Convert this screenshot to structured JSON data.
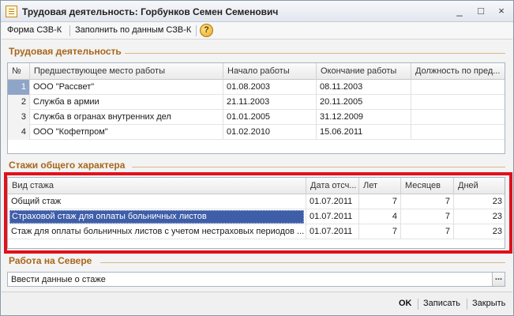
{
  "window": {
    "title": "Трудовая деятельность: Горбунков Семен Семенович",
    "minimize": "_",
    "maximize": "□",
    "close": "×"
  },
  "toolbar": {
    "form_button": "Форма СЗВ-К",
    "fill_button": "Заполнить по данным СЗВ-К",
    "help": "?"
  },
  "work_section": {
    "title": "Трудовая деятельность",
    "columns": [
      "№",
      "Предшествующее место работы",
      "Начало работы",
      "Окончание работы",
      "Должность по пред..."
    ],
    "rows": [
      {
        "num": "1",
        "place": "ООО \"Рассвет\"",
        "start": "01.08.2003",
        "end": "08.11.2003",
        "position": ""
      },
      {
        "num": "2",
        "place": "Служба в армии",
        "start": "21.11.2003",
        "end": "20.11.2005",
        "position": ""
      },
      {
        "num": "3",
        "place": "Служба в огранах внутренних дел",
        "start": "01.01.2005",
        "end": "31.12.2009",
        "position": ""
      },
      {
        "num": "4",
        "place": "ООО \"Кофетпром\"",
        "start": "01.02.2010",
        "end": "15.06.2011",
        "position": ""
      }
    ]
  },
  "experience_section": {
    "title": "Стажи общего характера",
    "columns": [
      "Вид стажа",
      "Дата отсч...",
      "Лет",
      "Месяцев",
      "Дней"
    ],
    "rows": [
      {
        "type": "Общий стаж",
        "date": "01.07.2011",
        "years": "7",
        "months": "7",
        "days": "23"
      },
      {
        "type": "Страховой стаж для оплаты больничных листов",
        "date": "01.07.2011",
        "years": "4",
        "months": "7",
        "days": "23"
      },
      {
        "type": "Стаж для оплаты больничных листов с учетом нестраховых периодов ...",
        "date": "01.07.2011",
        "years": "7",
        "months": "7",
        "days": "23"
      }
    ]
  },
  "north_section": {
    "title": "Работа на Севере",
    "input_value": "Ввести данные о стаже",
    "dots": "..."
  },
  "bottom": {
    "ok": "OK",
    "save": "Записать",
    "close": "Закрыть"
  }
}
